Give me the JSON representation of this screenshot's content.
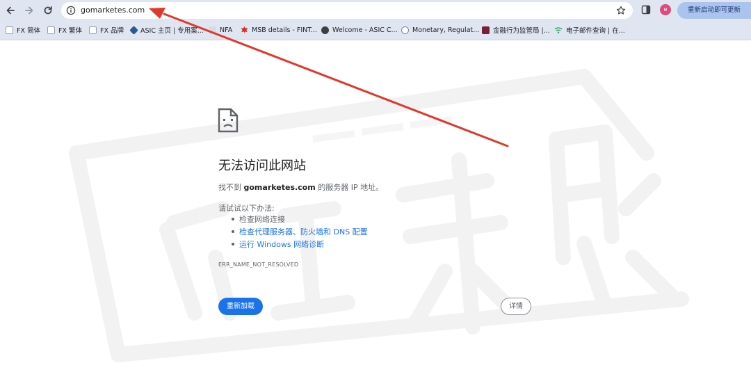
{
  "browser": {
    "url": "gomarketes.com",
    "update_button": "重新启动即可更新",
    "profile_initial": "e"
  },
  "bookmarks": [
    {
      "label": "FX 简体"
    },
    {
      "label": "FX 繁体"
    },
    {
      "label": "FX 品牌"
    },
    {
      "label": "ASIC 主页 | 专用案..."
    },
    {
      "label": "NFA"
    },
    {
      "label": "MSB details - FINT..."
    },
    {
      "label": "Welcome - ASIC C..."
    },
    {
      "label": "Monetary, Regulat..."
    },
    {
      "label": "金融行为监管局 |..."
    },
    {
      "label": "电子邮件查询 | 在..."
    }
  ],
  "error": {
    "title": "无法访问此网站",
    "desc_prefix": "找不到 ",
    "desc_domain": "gomarketes.com",
    "desc_suffix": " 的服务器 IP 地址。",
    "try_heading": "请试试以下办法:",
    "suggestions": [
      {
        "label": "检查网络连接",
        "link": false
      },
      {
        "label": "检查代理服务器、防火墙和 DNS 配置",
        "link": true
      },
      {
        "label": "运行 Windows 网络诊断",
        "link": true
      }
    ],
    "code": "ERR_NAME_NOT_RESOLVED",
    "reload_label": "重新加载",
    "details_label": "详情"
  },
  "colors": {
    "toolbar_bg": "#dfe6f2",
    "link": "#1a73e8",
    "primary_button": "#1a73e8",
    "annotation_arrow": "#e0382b"
  }
}
